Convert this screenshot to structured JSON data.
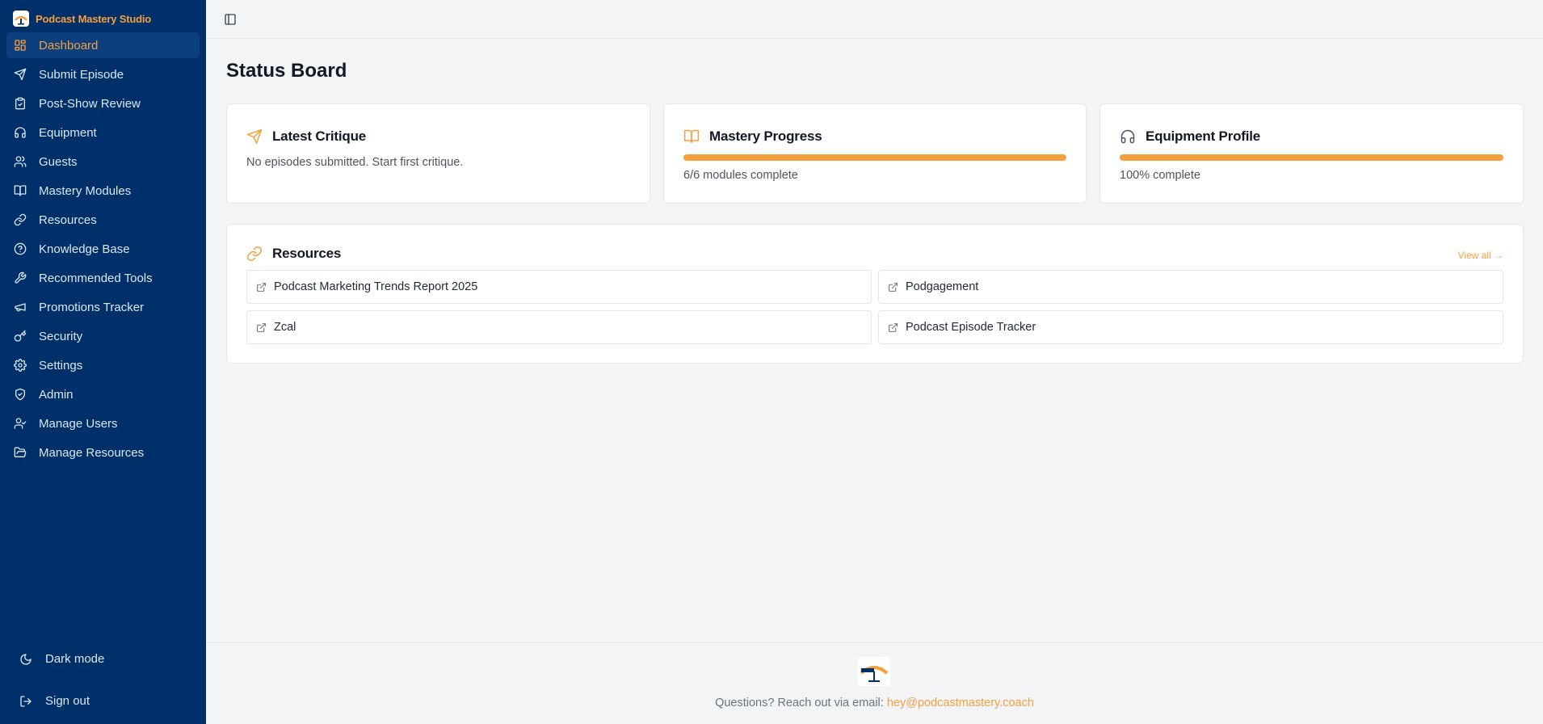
{
  "brand": {
    "name": "Podcast Mastery Studio"
  },
  "colors": {
    "sidebar": "#00306a",
    "accent": "#f59f3e",
    "active_bg": "#0b3f7e",
    "background": "#f3f4f6"
  },
  "sidebar": {
    "items": [
      {
        "label": "Dashboard",
        "icon": "dashboard-icon",
        "active": true
      },
      {
        "label": "Submit Episode",
        "icon": "send-icon"
      },
      {
        "label": "Post-Show Review",
        "icon": "clipboard-check-icon"
      },
      {
        "label": "Equipment",
        "icon": "headphones-icon"
      },
      {
        "label": "Guests",
        "icon": "users-icon"
      },
      {
        "label": "Mastery Modules",
        "icon": "book-open-icon"
      },
      {
        "label": "Resources",
        "icon": "link-icon"
      },
      {
        "label": "Knowledge Base",
        "icon": "help-circle-icon"
      },
      {
        "label": "Recommended Tools",
        "icon": "wrench-icon"
      },
      {
        "label": "Promotions Tracker",
        "icon": "megaphone-icon"
      },
      {
        "label": "Security",
        "icon": "key-icon"
      },
      {
        "label": "Settings",
        "icon": "gear-icon"
      },
      {
        "label": "Admin",
        "icon": "shield-check-icon"
      },
      {
        "label": "Manage Users",
        "icon": "user-check-icon"
      },
      {
        "label": "Manage Resources",
        "icon": "folder-open-icon"
      }
    ],
    "dark_mode_label": "Dark mode",
    "sign_out_label": "Sign out"
  },
  "main": {
    "title": "Status Board",
    "cards": {
      "critique": {
        "title": "Latest Critique",
        "text": "No episodes submitted. Start first critique.",
        "icon": "send-icon"
      },
      "mastery": {
        "title": "Mastery Progress",
        "text": "6/6 modules complete",
        "progress": 1.0,
        "icon": "book-open-icon"
      },
      "equipment": {
        "title": "Equipment Profile",
        "text": "100% complete",
        "progress": 1.0,
        "icon": "headphones-icon"
      }
    },
    "resources": {
      "title": "Resources",
      "view_all": "View all →",
      "items": [
        "Podcast Marketing Trends Report 2025",
        "Podgagement",
        "Zcal",
        "Podcast Episode Tracker"
      ]
    }
  },
  "footer": {
    "text": "Questions? Reach out via email:",
    "email": "hey@podcastmastery.coach"
  }
}
